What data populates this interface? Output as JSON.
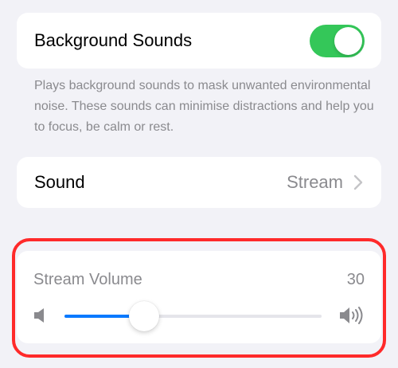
{
  "background_sounds": {
    "label": "Background Sounds",
    "toggle_on": true,
    "toggle_color": "#34c759",
    "footnote": "Plays background sounds to mask unwanted environmental noise. These sounds can minimise distractions and help you to focus, be calm or rest."
  },
  "sound": {
    "label": "Sound",
    "value": "Stream",
    "chevron_icon": "chevron-right-icon"
  },
  "stream_volume": {
    "label": "Stream Volume",
    "value": "30",
    "slider_fraction": 0.31,
    "fill_color": "#0a7aff",
    "low_icon": "speaker-low-icon",
    "high_icon": "speaker-high-icon"
  },
  "highlight_color": "#ff2a2a"
}
